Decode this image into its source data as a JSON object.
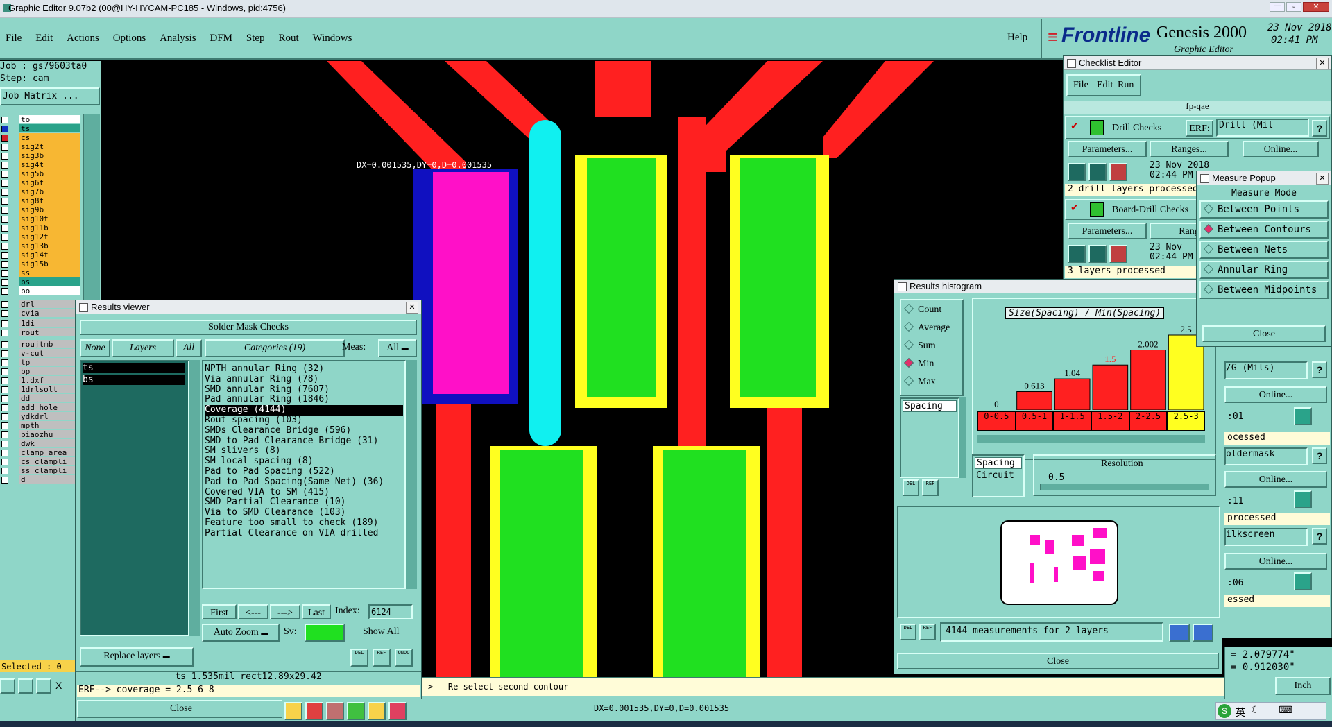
{
  "titlebar": {
    "title": "Graphic Editor 9.07b2 (00@HY-HYCAM-PC185 - Windows, pid:4756)"
  },
  "menubar": {
    "items": [
      "File",
      "Edit",
      "Actions",
      "Options",
      "Analysis",
      "DFM",
      "Step",
      "Rout",
      "Windows"
    ],
    "help": "Help"
  },
  "brand": {
    "logo": "Frontline",
    "product": "Genesis 2000",
    "subtitle": "Graphic Editor",
    "date": "23 Nov 2018",
    "time": "02:41 PM"
  },
  "job": {
    "job_label": "Job : gs79603ta0",
    "step_label": "Step: cam",
    "matrix_button": "Job Matrix ..."
  },
  "layers": [
    {
      "name": "to",
      "color": "#ffffff"
    },
    {
      "name": "ts",
      "color": "#2aa38a"
    },
    {
      "name": "cs",
      "color": "#f7b733"
    },
    {
      "name": "sig2t",
      "color": "#f7b733"
    },
    {
      "name": "sig3b",
      "color": "#f7b733"
    },
    {
      "name": "sig4t",
      "color": "#f7b733"
    },
    {
      "name": "sig5b",
      "color": "#f7b733"
    },
    {
      "name": "sig6t",
      "color": "#f7b733"
    },
    {
      "name": "sig7b",
      "color": "#f7b733"
    },
    {
      "name": "sig8t",
      "color": "#f7b733"
    },
    {
      "name": "sig9b",
      "color": "#f7b733"
    },
    {
      "name": "sig10t",
      "color": "#f7b733"
    },
    {
      "name": "sig11b",
      "color": "#f7b733"
    },
    {
      "name": "sig12t",
      "color": "#f7b733"
    },
    {
      "name": "sig13b",
      "color": "#f7b733"
    },
    {
      "name": "sig14t",
      "color": "#f7b733"
    },
    {
      "name": "sig15b",
      "color": "#f7b733"
    },
    {
      "name": "ss",
      "color": "#f7b733"
    },
    {
      "name": "bs",
      "color": "#2aa38a"
    },
    {
      "name": "bo",
      "color": "#ffffff"
    },
    {
      "name": "drl",
      "color": "#bfbfbf"
    },
    {
      "name": "cvia",
      "color": "#bfbfbf"
    },
    {
      "name": "1di",
      "color": "#bfbfbf"
    },
    {
      "name": "rout",
      "color": "#bfbfbf"
    },
    {
      "name": "roujtmb",
      "color": "#bfbfbf"
    },
    {
      "name": "v-cut",
      "color": "#bfbfbf"
    },
    {
      "name": "tp",
      "color": "#bfbfbf"
    },
    {
      "name": "bp",
      "color": "#bfbfbf"
    },
    {
      "name": "1.dxf",
      "color": "#bfbfbf"
    },
    {
      "name": "1drlsolt",
      "color": "#bfbfbf"
    },
    {
      "name": "dd",
      "color": "#bfbfbf"
    },
    {
      "name": "add_hole",
      "color": "#bfbfbf"
    },
    {
      "name": "ydkdrl",
      "color": "#bfbfbf"
    },
    {
      "name": "mpth",
      "color": "#bfbfbf"
    },
    {
      "name": "biaozhu",
      "color": "#bfbfbf"
    },
    {
      "name": "dwk",
      "color": "#bfbfbf"
    },
    {
      "name": "clamp_area",
      "color": "#bfbfbf"
    },
    {
      "name": "cs_clampli",
      "color": "#bfbfbf"
    },
    {
      "name": "ss_clampli",
      "color": "#bfbfbf"
    },
    {
      "name": "d",
      "color": "#bfbfbf"
    }
  ],
  "left_status": {
    "selected": "Selected : 0",
    "x_label": "X"
  },
  "canvas": {
    "measure_text": "DX=0.001535,DY=0,D=0.001535"
  },
  "results_viewer": {
    "title": "Results viewer",
    "header": "Solder Mask Checks",
    "none_btn": "None",
    "layers_btn": "Layers",
    "all_btn": "All",
    "categories_label": "Categories (19)",
    "meas_label": "Meas:",
    "meas_value": "All",
    "layers_list": [
      "ts",
      "bs"
    ],
    "categories": [
      "NPTH annular Ring (32)",
      "Via annular Ring (78)",
      "SMD annular Ring (7607)",
      "Pad annular Ring (1846)",
      "Coverage (4144)",
      "Rout spacing (103)",
      "SMDs Clearance Bridge (596)",
      "SMD to Pad Clearance Bridge (31)",
      "SM slivers (8)",
      "SM local spacing (8)",
      "Pad to Pad Spacing (522)",
      "Pad to Pad Spacing(Same Net) (36)",
      "Covered VIA to SM (415)",
      "SMD Partial Clearance (10)",
      "Via to SMD Clearance (103)",
      "Feature too small to check (189)",
      "Partial Clearance on VIA drilled"
    ],
    "selected_category": "Coverage (4144)",
    "nav": {
      "first": "First",
      "prev": "<---",
      "next": "--->",
      "last": "Last",
      "index_label": "Index:",
      "index_value": "6124"
    },
    "auto_zoom": "Auto Zoom",
    "sv_label": "Sv:",
    "show_all": "Show All",
    "replace_layers": "Replace layers",
    "del_label": "DEL",
    "ref_label": "REF",
    "undo_label": "UNDO",
    "info_line": "ts 1.535mil   rect12.89x29.42",
    "erf_line": "ERF--> coverage = 2.5 6 8",
    "close": "Close"
  },
  "histogram": {
    "title": "Results histogram",
    "modes": [
      {
        "label": "Count",
        "on": false
      },
      {
        "label": "Average",
        "on": false
      },
      {
        "label": "Sum",
        "on": false
      },
      {
        "label": "Min",
        "on": true
      },
      {
        "label": "Max",
        "on": false
      }
    ],
    "chart_title": "Size(Spacing) / Min(Spacing)",
    "list_items": [
      "Spacing"
    ],
    "category_list": [
      "Spacing",
      "Circuit"
    ],
    "resolution_label": "Resolution",
    "resolution_value": "0.5",
    "del_label": "DEL",
    "ref_label": "REF",
    "measurements": "4144 measurements for 2 layers",
    "close": "Close"
  },
  "chart_data": {
    "type": "bar",
    "title": "Size(Spacing) / Min(Spacing)",
    "categories": [
      "0-0.5",
      "0.5-1",
      "1-1.5",
      "1.5-2",
      "2-2.5",
      "2.5-3"
    ],
    "values": [
      0,
      0.613,
      1.04,
      1.5,
      2.002,
      2.5
    ],
    "labels": [
      "0",
      "0.613",
      "1.04",
      "1.5",
      "2.002",
      "2.5"
    ],
    "highlight_index": 5,
    "colors": {
      "bar": "#ff2020",
      "highlight": "#ffff20",
      "label_highlight": "#ff2020"
    },
    "ylim": [
      0,
      2.5
    ]
  },
  "checklist": {
    "title": "Checklist Editor",
    "menu": [
      "File",
      "Edit",
      "Run"
    ],
    "name": "fp-qae",
    "checks": [
      {
        "name": "Drill Checks",
        "erf_label": "ERF:",
        "erf_value": "Drill (Mil",
        "date": "23 Nov 2018",
        "time": "02:44 PM",
        "status": "2 drill layers processed"
      },
      {
        "name": "Board-Drill Checks",
        "date": "23 Nov",
        "time": "02:44 PM",
        "status": "3 layers processed"
      }
    ],
    "parameters": "Parameters...",
    "ranges": "Ranges...",
    "ranges_short": "Rang",
    "online": "Online...",
    "partial_rows": [
      {
        "label": "/G (Mils)",
        "time": ":01",
        "status": "ocessed"
      },
      {
        "label": "oldermask",
        "time": ":11",
        "status": "processed"
      },
      {
        "label": "ilkscreen",
        "time": ":06",
        "status": "essed"
      }
    ]
  },
  "measure_popup": {
    "title": "Measure Popup",
    "header": "Measure Mode",
    "modes": [
      {
        "label": "Between Points",
        "on": false
      },
      {
        "label": "Between Contours",
        "on": true
      },
      {
        "label": "Between Nets",
        "on": false
      },
      {
        "label": "Annular Ring",
        "on": false
      },
      {
        "label": "Between Midpoints",
        "on": false
      }
    ],
    "close": "Close"
  },
  "status": {
    "prompt": "> - Re-select second contour",
    "coords": "DX=0.001535,DY=0,D=0.001535",
    "x_readout": "= 2.079774\"",
    "y_readout": "= 0.912030\"",
    "units": "Inch"
  },
  "taskbar": {
    "ime": "英"
  }
}
